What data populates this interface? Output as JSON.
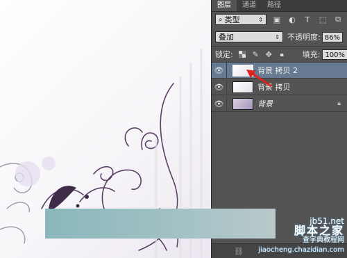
{
  "tabs": [
    "图层",
    "通道",
    "路径"
  ],
  "filter": {
    "kind_label": "类型",
    "icons": [
      "image-filter-icon",
      "adjustment-filter-icon",
      "text-filter-icon",
      "shape-filter-icon",
      "smart-object-filter-icon"
    ]
  },
  "blend": {
    "mode": "叠加",
    "opacity_label": "不透明度:",
    "opacity_value": "86%"
  },
  "lock": {
    "label": "锁定:",
    "fill_label": "填充:",
    "fill_value": "100%"
  },
  "layers": [
    {
      "name": "背景 拷贝 2",
      "selected": true
    },
    {
      "name": "背景 拷贝",
      "selected": false
    },
    {
      "name": "背景",
      "selected": false,
      "locked": true
    }
  ],
  "watermark": {
    "site": "jb51.net",
    "brand": "脚本之家",
    "line2": "查字典教程网",
    "url": "jiaocheng.chazidian.com"
  },
  "colors": {
    "panel": "#535353",
    "selected_layer": "#667a91",
    "teal_bar": "#8ab7bb"
  }
}
